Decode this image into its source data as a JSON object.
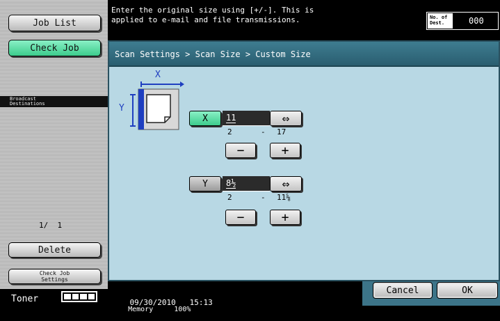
{
  "left_panel": {
    "job_list_label": "Job List",
    "check_job_label": "Check Job",
    "broadcast_label": "Broadcast\nDestinations",
    "page_counter": "1/  1",
    "delete_label": "Delete",
    "check_job_settings_label": "Check Job\nSettings",
    "toner_label": "Toner",
    "toner_level": 1.0
  },
  "message": {
    "text": "Enter the original size using [+/-]. This is\napplied to e-mail and file transmissions.",
    "dest_label": "No. of\nDest.",
    "dest_count": "000"
  },
  "breadcrumb": "Scan Settings > Scan Size > Custom Size",
  "diagram": {
    "x_label": "X",
    "y_label": "Y"
  },
  "x_control": {
    "label": "X",
    "value": "11",
    "range_min": "2",
    "range_sep": "-",
    "range_max": "17",
    "swap_glyph": "⇔",
    "minus_glyph": "−",
    "plus_glyph": "+",
    "active": true
  },
  "y_control": {
    "label": "Y",
    "value": "8½",
    "range_min": "2",
    "range_sep": "-",
    "range_max": "11⅝",
    "swap_glyph": "⇔",
    "minus_glyph": "−",
    "plus_glyph": "+",
    "active": false
  },
  "status": {
    "date": "09/30/2010",
    "time": "15:13",
    "memory_label": "Memory",
    "memory_value": "100%"
  },
  "footer": {
    "cancel_label": "Cancel",
    "ok_label": "OK"
  },
  "colors": {
    "accent_green": "#3ccc8c",
    "panel_blue": "#b8d8e4",
    "header_blue": "#3e7c90",
    "diagram_blue": "#1f3fc0"
  }
}
